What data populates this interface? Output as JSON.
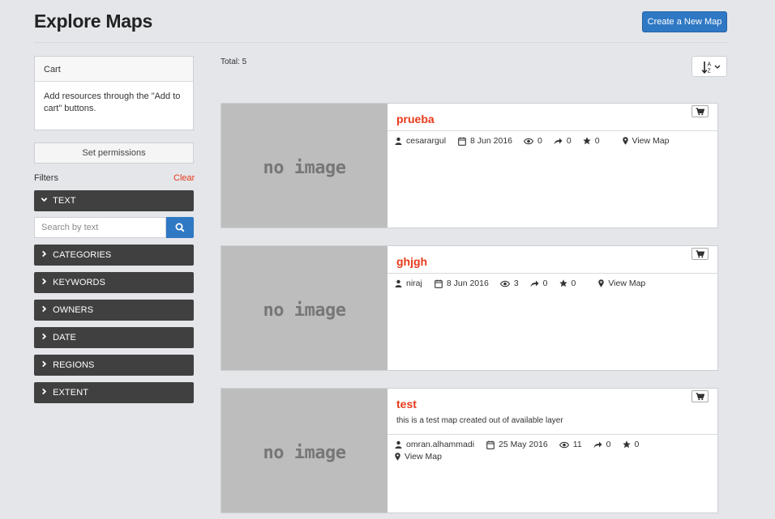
{
  "header": {
    "title": "Explore Maps",
    "create_label": "Create a New Map"
  },
  "sidebar": {
    "cart_title": "Cart",
    "cart_text": "Add resources through the \"Add to cart\" buttons.",
    "permissions_label": "Set permissions",
    "filters_label": "Filters",
    "clear_label": "Clear",
    "text_filter_label": "TEXT",
    "search_placeholder": "Search by text",
    "filters": [
      "CATEGORIES",
      "KEYWORDS",
      "OWNERS",
      "DATE",
      "REGIONS",
      "EXTENT"
    ]
  },
  "main": {
    "total_label": "Total: 5",
    "no_image_text": "no image",
    "view_map_label": "View Map",
    "maps": [
      {
        "title": "prueba",
        "description": "",
        "owner": "cesarargul",
        "date": "8 Jun 2016",
        "views": "0",
        "shares": "0",
        "rating": "0"
      },
      {
        "title": "ghjgh",
        "description": "",
        "owner": "niraj",
        "date": "8 Jun 2016",
        "views": "3",
        "shares": "0",
        "rating": "0"
      },
      {
        "title": "test",
        "description": "this is a test map created out of available layer",
        "owner": "omran.alhammadi",
        "date": "25 May 2016",
        "views": "11",
        "shares": "0",
        "rating": "0"
      }
    ]
  },
  "colors": {
    "accent_blue": "#2f78c4",
    "title_red": "#e8391a",
    "filter_dark": "#404040"
  }
}
